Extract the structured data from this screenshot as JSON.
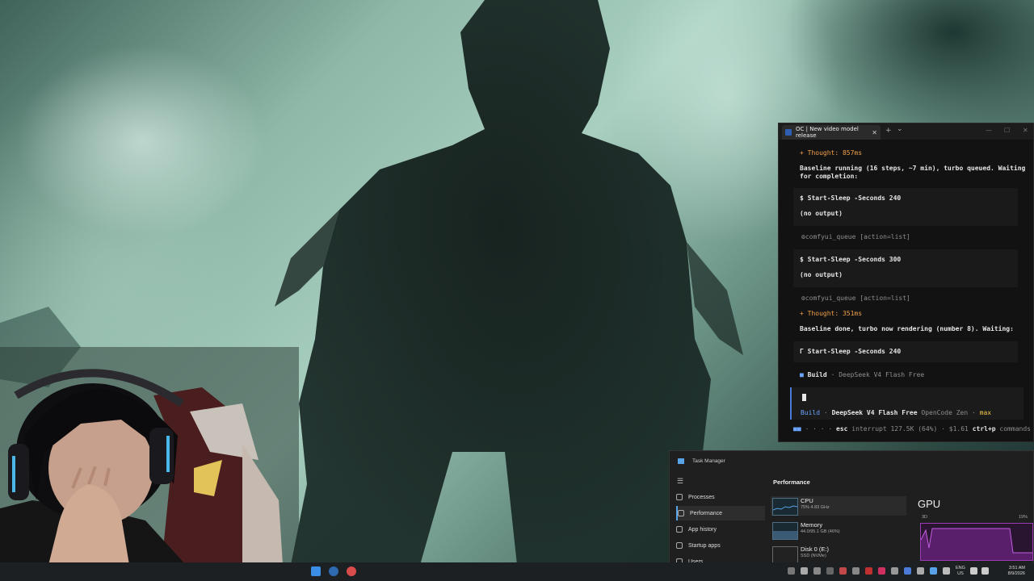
{
  "terminal": {
    "tab_title": "OC | New video model release",
    "new_tab": "+",
    "tab_dropdown": "⌄",
    "lines": {
      "thought1": "+ Thought: 857ms",
      "msg1_a": "Baseline running (16 steps, ~7 min), turbo queued. Waiting",
      "msg1_b": "for completion:",
      "cmd1": "$ Start-Sleep -Seconds 240",
      "out1": "(no output)",
      "tool1": "comfyui_queue [action=list]",
      "cmd2": "$ Start-Sleep -Seconds 300",
      "out2": "(no output)",
      "tool2": "comfyui_queue [action=list]",
      "thought2": "+ Thought: 351ms",
      "msg2": "Baseline done, turbo now rendering (number 8). Waiting:",
      "cmd3": "Start-Sleep -Seconds 240",
      "cmd3_prefix": "Γ"
    },
    "status_row": {
      "mode": "Build",
      "sep": "·",
      "model": "DeepSeek V4 Flash Free"
    },
    "input_footer": {
      "mode": "Build",
      "sep": "·",
      "model": "DeepSeek V4 Flash Free",
      "provider": "OpenCode Zen",
      "sep2": "·",
      "variant": "max"
    },
    "bottom_bar": {
      "esc_key": "esc",
      "esc_label": "interrupt",
      "tokens": "127.5K (64%)",
      "sep": "·",
      "cost": "$1.61",
      "cmd_key": "ctrl+p",
      "cmd_label": "commands",
      "dots": "· · · ·"
    }
  },
  "task_manager": {
    "title": "Task Manager",
    "nav": [
      {
        "label": "Processes",
        "active": false
      },
      {
        "label": "Performance",
        "active": true
      },
      {
        "label": "App history",
        "active": false
      },
      {
        "label": "Startup apps",
        "active": false
      },
      {
        "label": "Users",
        "active": false
      }
    ],
    "section_title": "Performance",
    "resources": [
      {
        "name": "CPU",
        "sub": "75% 4.83 GHz"
      },
      {
        "name": "Memory",
        "sub": "44.0/95.1 GB (46%)"
      },
      {
        "name": "Disk 0 (E:)",
        "sub": "SSD (NVMe)"
      }
    ],
    "gpu": {
      "title": "GPU",
      "engine_label": "3D",
      "engine_pct": "19%"
    }
  },
  "taskbar": {
    "lang_top": "ENG",
    "lang_bottom": "US",
    "time": "3:51 AM",
    "date": "8/9/2026"
  },
  "colors": {
    "terminal_bg": "#121212",
    "accent_blue": "#4a7bd8",
    "thought_orange": "#f2a14a",
    "gpu_purple": "#9b3bb3"
  }
}
